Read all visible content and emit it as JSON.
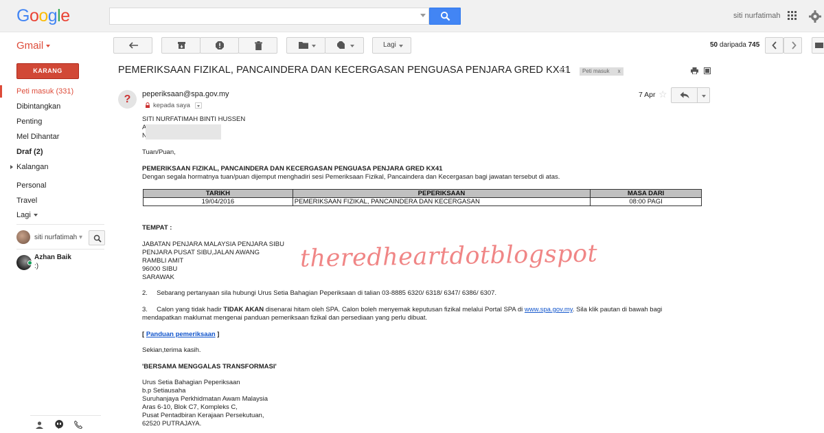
{
  "header": {
    "logo_text": "Google",
    "username": "siti nurfatimah",
    "search": {
      "value": "",
      "placeholder": ""
    }
  },
  "toolbar": {
    "app_label": "Gmail",
    "more_label": "Lagi",
    "paging": {
      "range": "50",
      "middle": "daripada",
      "total": "745"
    }
  },
  "sidebar": {
    "compose_label": "KARANG",
    "items": [
      {
        "label": "Peti masuk (331)",
        "active": true,
        "bold": false
      },
      {
        "label": "Dibintangkan",
        "active": false,
        "bold": false
      },
      {
        "label": "Penting",
        "active": false,
        "bold": false
      },
      {
        "label": "Mel Dihantar",
        "active": false,
        "bold": false
      },
      {
        "label": "Draf (2)",
        "active": false,
        "bold": true
      },
      {
        "label": "Kalangan",
        "active": false,
        "bold": false
      },
      {
        "label": "Personal",
        "active": false,
        "bold": false
      },
      {
        "label": "Travel",
        "active": false,
        "bold": false
      },
      {
        "label": "Lagi",
        "active": false,
        "bold": false
      }
    ],
    "hangouts": {
      "self_name": "siti nurfatimah",
      "contact_name": "Azhan Baik",
      "contact_status": ":)"
    }
  },
  "email": {
    "subject": "PEMERIKSAAN FIZIKAL, PANCAINDERA DAN KECERGASAN PENGUASA PENJARA GRED KX41",
    "label_chip": "Peti masuk",
    "label_chip_close": "x",
    "sender_initial": "?",
    "sender_email": "peperiksaan@spa.gov.my",
    "to_me": "kepada saya",
    "date": "7 Apr",
    "body": {
      "recipient_name": "SITI NURFATIMAH BINTI HUSSEN",
      "recipient_line2": "A",
      "recipient_line3": "N",
      "salutation": "Tuan/Puan,",
      "heading": "PEMERIKSAAN FIZIKAL, PANCAINDERA DAN KECERGASAN PENGUASA PENJARA GRED KX41",
      "intro": "Dengan segala hormatnya tuan/puan dijemput menghadiri sesi Pemeriksaan Fizikal, Pancaindera dan Kecergasan bagi jawatan tersebut di atas.",
      "table": {
        "headers": [
          "TARIKH",
          "PEPERIKSAAN",
          "MASA DARI"
        ],
        "rows": [
          [
            "19/04/2016",
            "PEMERIKSAAN FIZIKAL, PANCAINDERA DAN KECERGASAN",
            "08:00 PAGI"
          ]
        ]
      },
      "place_label": "TEMPAT :",
      "address": [
        "JABATAN PENJARA MALAYSIA PENJARA SIBU",
        "PENJARA PUSAT SIBU,JALAN AWANG",
        "RAMBLI AMIT",
        "96000 SIBU",
        "SARAWAK"
      ],
      "para2": "2.     Sebarang pertanyaan sila hubungi Urus Setia Bahagian Peperiksaan di talian 03-8885 6320/ 6318/ 6347/ 6386/ 6307.",
      "para3_a": "3.     Calon yang tidak hadir ",
      "para3_b": "TIDAK AKAN",
      "para3_c": " disenarai hitam oleh SPA. Calon boleh menyemak keputusan fizikal melalui Portal SPA di ",
      "para3_link": "www.spa.gov.my",
      "para3_d": ". Sila klik pautan di bawah bagi",
      "para3_line2": "mendapatkan maklumat mengenai panduan pemeriksaan fizikal dan persediaan yang perlu dibuat.",
      "guide_open": "[ ",
      "guide_link": "Panduan pemeriksaan",
      "guide_close": " ]",
      "closing": "Sekian,terima kasih.",
      "motto": "'BERSAMA MENGGALAS TRANSFORMASI'",
      "signature": [
        "Urus Setia Bahagian Peperiksaan",
        "b.p Setiausaha",
        "Suruhanjaya Perkhidmatan Awam Malaysia",
        "Aras 6-10, Blok C7, Kompleks C,",
        "Pusat Pentadbiran Kerajaan Persekutuan,",
        "62520 PUTRAJAYA."
      ]
    }
  },
  "watermark": "theredheartdotblogspot",
  "colors": {
    "google_blue": "#4285f4",
    "google_red": "#ea4335",
    "google_yellow": "#fbbc05",
    "google_green": "#34a853",
    "gmail_red": "#dd4b39",
    "compose_red": "#d14836",
    "link_blue": "#1155cc",
    "watermark_pink": "#f08080"
  }
}
